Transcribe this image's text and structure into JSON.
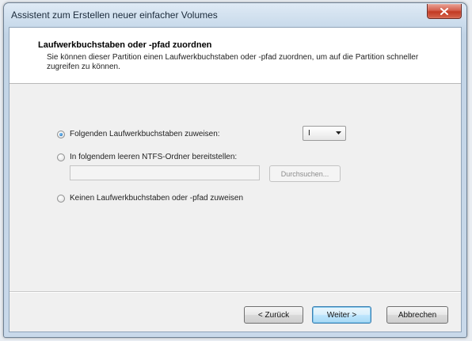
{
  "window": {
    "title": "Assistent zum Erstellen neuer einfacher Volumes"
  },
  "header": {
    "title": "Laufwerkbuchstaben oder -pfad zuordnen",
    "description": "Sie können dieser Partition einen Laufwerkbuchstaben oder -pfad zuordnen, um auf die Partition schneller zugreifen zu können."
  },
  "options": {
    "assign_letter": {
      "label": "Folgenden Laufwerkbuchstaben zuweisen:",
      "checked": true,
      "selected_value": "I"
    },
    "mount_folder": {
      "label": "In folgendem leeren NTFS-Ordner bereitstellen:",
      "checked": false,
      "path_value": "",
      "browse_label": "Durchsuchen..."
    },
    "no_letter": {
      "label": "Keinen Laufwerkbuchstaben oder -pfad zuweisen",
      "checked": false
    }
  },
  "buttons": {
    "back": "< Zurück",
    "next": "Weiter >",
    "cancel": "Abbrechen"
  },
  "colors": {
    "close_button": "#c9442d",
    "default_button_border": "#3c7fb1",
    "radio_dot": "#1c6fb8"
  },
  "icons": {
    "close": "close-icon",
    "dropdown": "chevron-down-icon"
  }
}
